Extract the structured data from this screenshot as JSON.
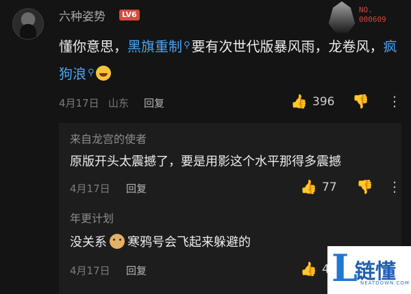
{
  "main_comment": {
    "username": "六种姿势",
    "level": "LV6",
    "badge_no": "NO.",
    "badge_number": "000609",
    "text_part1": "懂你意思，",
    "keyword1": "黑旗重制",
    "text_part2": "要有次世代版暴风雨，龙卷风，",
    "keyword2": "疯狗浪",
    "date": "4月17日",
    "location": "山东",
    "reply_label": "回复",
    "like_count": "396"
  },
  "replies": [
    {
      "username": "来自龙宫的使者",
      "text": "原版开头太震撼了，要是用影这个水平那得多震撼",
      "date": "4月17日",
      "reply_label": "回复",
      "like_count": "77"
    },
    {
      "username": "年更计划",
      "text_before": "没关系",
      "text_after": "寒鸦号会飞起来躲避的",
      "date": "4月17日",
      "reply_label": "回复",
      "like_count": "4"
    }
  ],
  "icons": {
    "search": "search-icon",
    "like": "thumbs-up-icon",
    "dislike": "thumbs-down-icon",
    "more": "more-vertical-icon"
  },
  "watermark": {
    "logo_letter": "L",
    "title": "链懂",
    "subtitle": "NEATDOWN.COM"
  },
  "colors": {
    "background": "#141414",
    "keyword": "#4ea3f1",
    "level_badge": "#d64b3a"
  }
}
